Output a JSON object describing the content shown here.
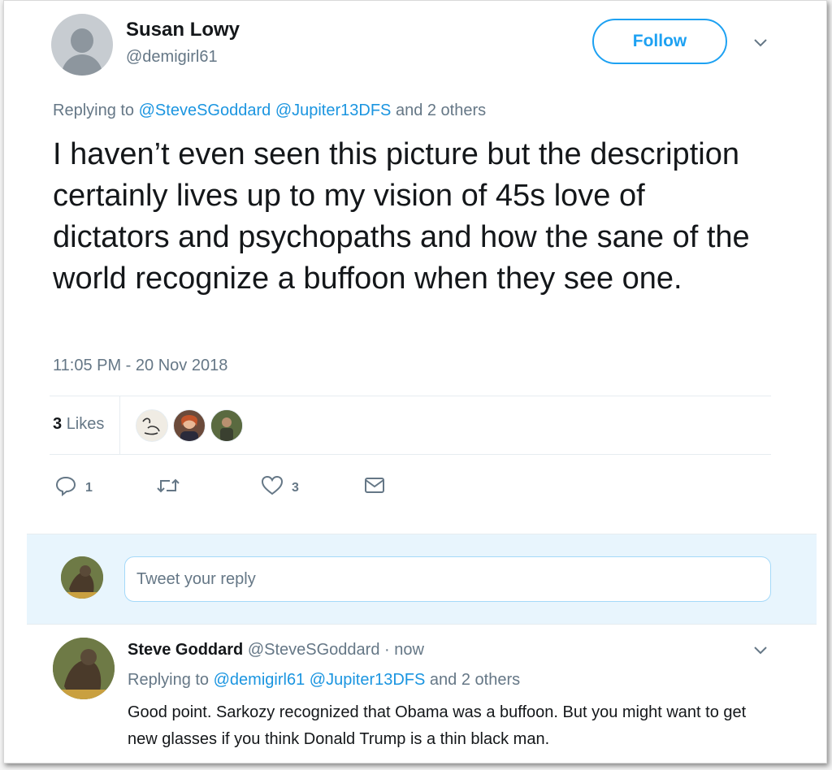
{
  "tweet": {
    "author_name": "Susan Lowy",
    "author_handle": "@demigirl61",
    "follow_label": "Follow",
    "replying_prefix": "Replying to",
    "replying_mention1": "@SteveSGoddard",
    "replying_mention2": "@Jupiter13DFS",
    "replying_suffix": "and 2 others",
    "text": "I haven’t even seen this picture but the description certainly lives up to my vision of 45s love of dictators and psychopaths and how the sane of the world recognize a buffoon when they see one.",
    "timestamp": "11:05 PM - 20 Nov 2018",
    "likes_number": "3",
    "likes_label": "Likes",
    "reply_count": "1",
    "like_count": "3"
  },
  "reply_box": {
    "placeholder": "Tweet your reply"
  },
  "reply": {
    "author_name": "Steve Goddard",
    "author_handle": "@SteveSGoddard",
    "separator": "·",
    "time": "now",
    "replying_prefix": "Replying to",
    "replying_mention1": "@demigirl61",
    "replying_mention2": "@Jupiter13DFS",
    "replying_suffix": "and 2 others",
    "text": "Good point.  Sarkozy recognized that Obama was a buffoon. But you might want to get new glasses if you think Donald Trump is a thin black man."
  },
  "icons": {
    "reply": "reply-icon",
    "retweet": "retweet-icon",
    "like": "heart-icon",
    "dm": "envelope-icon",
    "caret": "chevron-down-icon"
  },
  "colors": {
    "accent": "#1da1f2",
    "link": "#1b95e0",
    "muted": "#657786",
    "text": "#14171a"
  }
}
